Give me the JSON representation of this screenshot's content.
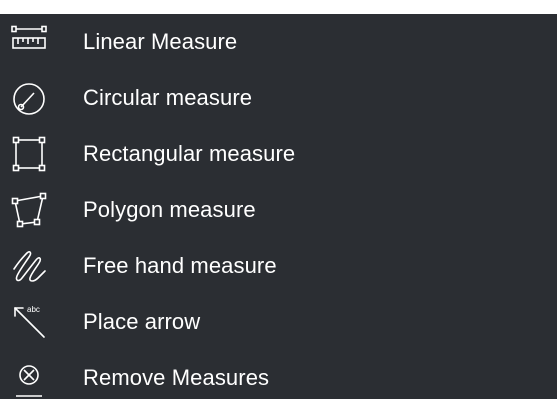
{
  "menu": {
    "items": [
      {
        "label": "Linear Measure",
        "icon": "ruler-icon"
      },
      {
        "label": "Circular measure",
        "icon": "circle-measure-icon"
      },
      {
        "label": "Rectangular measure",
        "icon": "rectangle-measure-icon"
      },
      {
        "label": "Polygon measure",
        "icon": "polygon-measure-icon"
      },
      {
        "label": "Free hand measure",
        "icon": "freehand-icon"
      },
      {
        "label": "Place arrow",
        "icon": "arrow-icon"
      },
      {
        "label": "Remove Measures",
        "icon": "remove-circle-x-icon"
      }
    ],
    "background": "#2b2e33",
    "text_color": "#ffffff",
    "icon_color": "#ffffff",
    "arrow_icon_text": "abc"
  }
}
